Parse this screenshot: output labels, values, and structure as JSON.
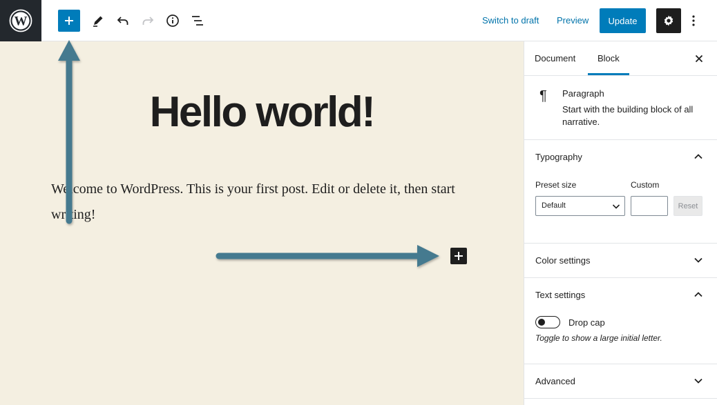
{
  "toolbar": {
    "switch_to_draft": "Switch to draft",
    "preview": "Preview",
    "update": "Update"
  },
  "post": {
    "title": "Hello world!",
    "paragraph": "Welcome to WordPress. This is your first post. Edit or delete it, then start writing!"
  },
  "sidebar": {
    "tabs": {
      "document": "Document",
      "block": "Block",
      "active": "Block"
    },
    "block_card": {
      "icon": "¶",
      "name": "Paragraph",
      "description": "Start with the building block of all narrative."
    },
    "typography": {
      "title": "Typography",
      "preset_size_label": "Preset size",
      "custom_label": "Custom",
      "preset_value": "Default",
      "custom_value": "",
      "reset_label": "Reset"
    },
    "color_settings": {
      "title": "Color settings"
    },
    "text_settings": {
      "title": "Text settings",
      "drop_cap_label": "Drop cap",
      "drop_cap_help": "Toggle to show a large initial letter.",
      "drop_cap_enabled": false
    },
    "advanced": {
      "title": "Advanced"
    }
  },
  "colors": {
    "accent": "#007cba",
    "canvas_bg": "#f4efe1",
    "annotation_arrow": "#457a8f"
  }
}
